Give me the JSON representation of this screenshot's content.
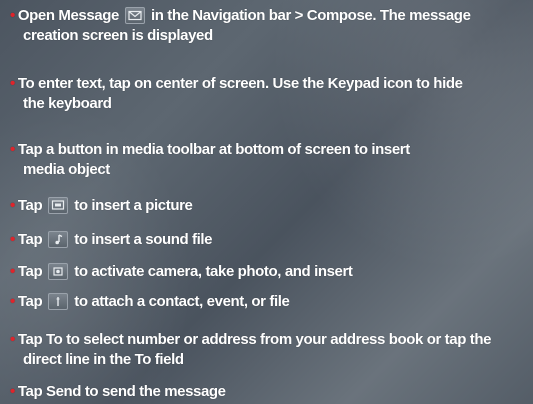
{
  "bullets": [
    {
      "before": "Open Message",
      "icon": "envelope-icon",
      "after": "in the Navigation bar > Compose. The message",
      "line2": "creation screen is  displayed"
    },
    {
      "text": "To enter text, tap on center of screen. Use the Keypad icon to hide",
      "line2": "the keyboard"
    },
    {
      "text": "Tap a button in media toolbar at bottom of screen to  insert",
      "line2": "media object"
    },
    {
      "before": "Tap",
      "icon": "picture-icon",
      "after": "to insert a picture"
    },
    {
      "before": "Tap",
      "icon": "music-note-icon",
      "after": "to insert a sound file"
    },
    {
      "before": "Tap",
      "icon": "camera-icon",
      "after": "to activate camera, take photo, and insert"
    },
    {
      "before": "Tap",
      "icon": "attachment-icon",
      "after": "to attach a contact, event, or file"
    },
    {
      "text": "Tap To to select number or address from your address book or tap the",
      "line2": "direct line in the To field"
    },
    {
      "text": "Tap Send to send the message"
    }
  ],
  "colors": {
    "bullet": "#e0242b",
    "text": "#ffffff"
  }
}
